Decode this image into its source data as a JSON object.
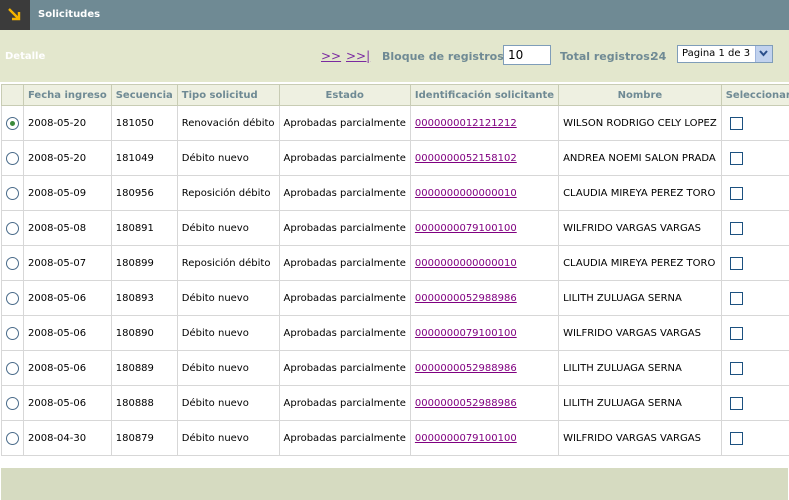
{
  "header": {
    "title": "Solicitudes"
  },
  "toolbar": {
    "detalle": "Detalle",
    "next_label": ">>",
    "last_label": ">>|",
    "bloque_label": "Bloque de registros:",
    "bloque_value": "10",
    "total_label": "Total registros:",
    "total_value": "24",
    "page_selected": "Pagina 1 de 3"
  },
  "table": {
    "columns": [
      "",
      "Fecha ingreso",
      "Secuencia",
      "Tipo solicitud",
      "Estado",
      "Identificación solicitante",
      "Nombre",
      "Seleccionar"
    ],
    "rows": [
      {
        "selected": true,
        "fecha": "2008-05-20",
        "secuencia": "181050",
        "tipo": "Renovación débito",
        "estado": "Aprobadas parcialmente",
        "identificacion": "0000000012121212",
        "nombre": "WILSON RODRIGO CELY LOPEZ"
      },
      {
        "selected": false,
        "fecha": "2008-05-20",
        "secuencia": "181049",
        "tipo": "Débito nuevo",
        "estado": "Aprobadas parcialmente",
        "identificacion": "0000000052158102",
        "nombre": "ANDREA NOEMI SALON PRADA"
      },
      {
        "selected": false,
        "fecha": "2008-05-09",
        "secuencia": "180956",
        "tipo": "Reposición débito",
        "estado": "Aprobadas parcialmente",
        "identificacion": "0000000000000010",
        "nombre": "CLAUDIA MIREYA PEREZ TORO"
      },
      {
        "selected": false,
        "fecha": "2008-05-08",
        "secuencia": "180891",
        "tipo": "Débito nuevo",
        "estado": "Aprobadas parcialmente",
        "identificacion": "0000000079100100",
        "nombre": "WILFRIDO VARGAS VARGAS"
      },
      {
        "selected": false,
        "fecha": "2008-05-07",
        "secuencia": "180899",
        "tipo": "Reposición débito",
        "estado": "Aprobadas parcialmente",
        "identificacion": "0000000000000010",
        "nombre": "CLAUDIA MIREYA PEREZ TORO"
      },
      {
        "selected": false,
        "fecha": "2008-05-06",
        "secuencia": "180893",
        "tipo": "Débito nuevo",
        "estado": "Aprobadas parcialmente",
        "identificacion": "0000000052988986",
        "nombre": "LILITH ZULUAGA SERNA"
      },
      {
        "selected": false,
        "fecha": "2008-05-06",
        "secuencia": "180890",
        "tipo": "Débito nuevo",
        "estado": "Aprobadas parcialmente",
        "identificacion": "0000000079100100",
        "nombre": "WILFRIDO VARGAS VARGAS"
      },
      {
        "selected": false,
        "fecha": "2008-05-06",
        "secuencia": "180889",
        "tipo": "Débito nuevo",
        "estado": "Aprobadas parcialmente",
        "identificacion": "0000000052988986",
        "nombre": "LILITH ZULUAGA SERNA"
      },
      {
        "selected": false,
        "fecha": "2008-05-06",
        "secuencia": "180888",
        "tipo": "Débito nuevo",
        "estado": "Aprobadas parcialmente",
        "identificacion": "0000000052988986",
        "nombre": "LILITH ZULUAGA SERNA"
      },
      {
        "selected": false,
        "fecha": "2008-04-30",
        "secuencia": "180879",
        "tipo": "Débito nuevo",
        "estado": "Aprobadas parcialmente",
        "identificacion": "0000000079100100",
        "nombre": "WILFRIDO VARGAS VARGAS"
      }
    ]
  },
  "icons": {
    "header": "arrow-down-right-icon",
    "select": "chevron-down-icon"
  },
  "colors": {
    "header_bg": "#6f8a94",
    "toolbar_bg": "#e3e7cd",
    "link": "#800080",
    "label": "#6f8a94"
  }
}
